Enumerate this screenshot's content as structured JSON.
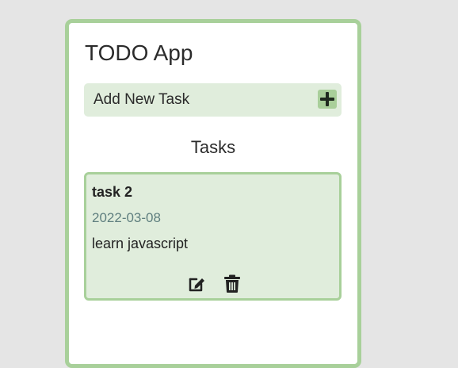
{
  "app": {
    "title": "TODO App"
  },
  "add_task": {
    "label": "Add New Task",
    "button_icon": "plus-icon"
  },
  "tasks_section": {
    "heading": "Tasks",
    "items": [
      {
        "title": "task 2",
        "date": "2022-03-08",
        "description": "learn javascript",
        "actions": [
          "edit-icon",
          "trash-icon"
        ]
      }
    ]
  },
  "colors": {
    "page_background": "#e5e5e5",
    "card_border": "#a8d09a",
    "accent_background": "#e0eddc",
    "date_text": "#5f7f7f"
  }
}
